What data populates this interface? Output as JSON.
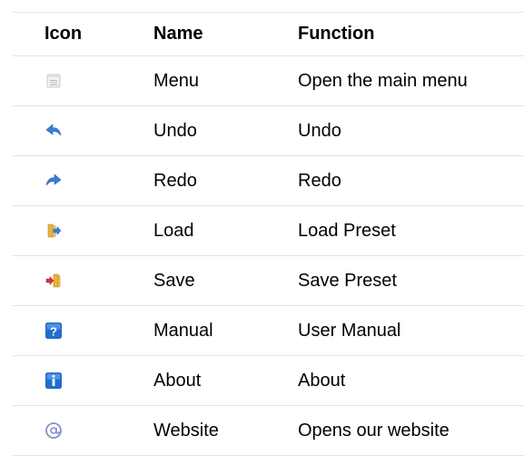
{
  "headers": {
    "icon": "Icon",
    "name": "Name",
    "function": "Function"
  },
  "rows": [
    {
      "icon": "menu-icon",
      "name": "Menu",
      "function": "Open the main menu"
    },
    {
      "icon": "undo-icon",
      "name": "Undo",
      "function": "Undo"
    },
    {
      "icon": "redo-icon",
      "name": "Redo",
      "function": "Redo"
    },
    {
      "icon": "load-preset-icon",
      "name": "Load",
      "function": "Load Preset"
    },
    {
      "icon": "save-preset-icon",
      "name": "Save",
      "function": "Save Preset"
    },
    {
      "icon": "manual-icon",
      "name": "Manual",
      "function": "User Manual"
    },
    {
      "icon": "about-icon",
      "name": "About",
      "function": "About"
    },
    {
      "icon": "website-icon",
      "name": "Website",
      "function": "Opens our website"
    }
  ],
  "colors": {
    "divider": "#e3e3e3",
    "arrow_blue": "#3a7fd6",
    "folder_yellow": "#e8b53a",
    "save_red": "#d8343c",
    "help_blue": "#1f6fd0"
  }
}
